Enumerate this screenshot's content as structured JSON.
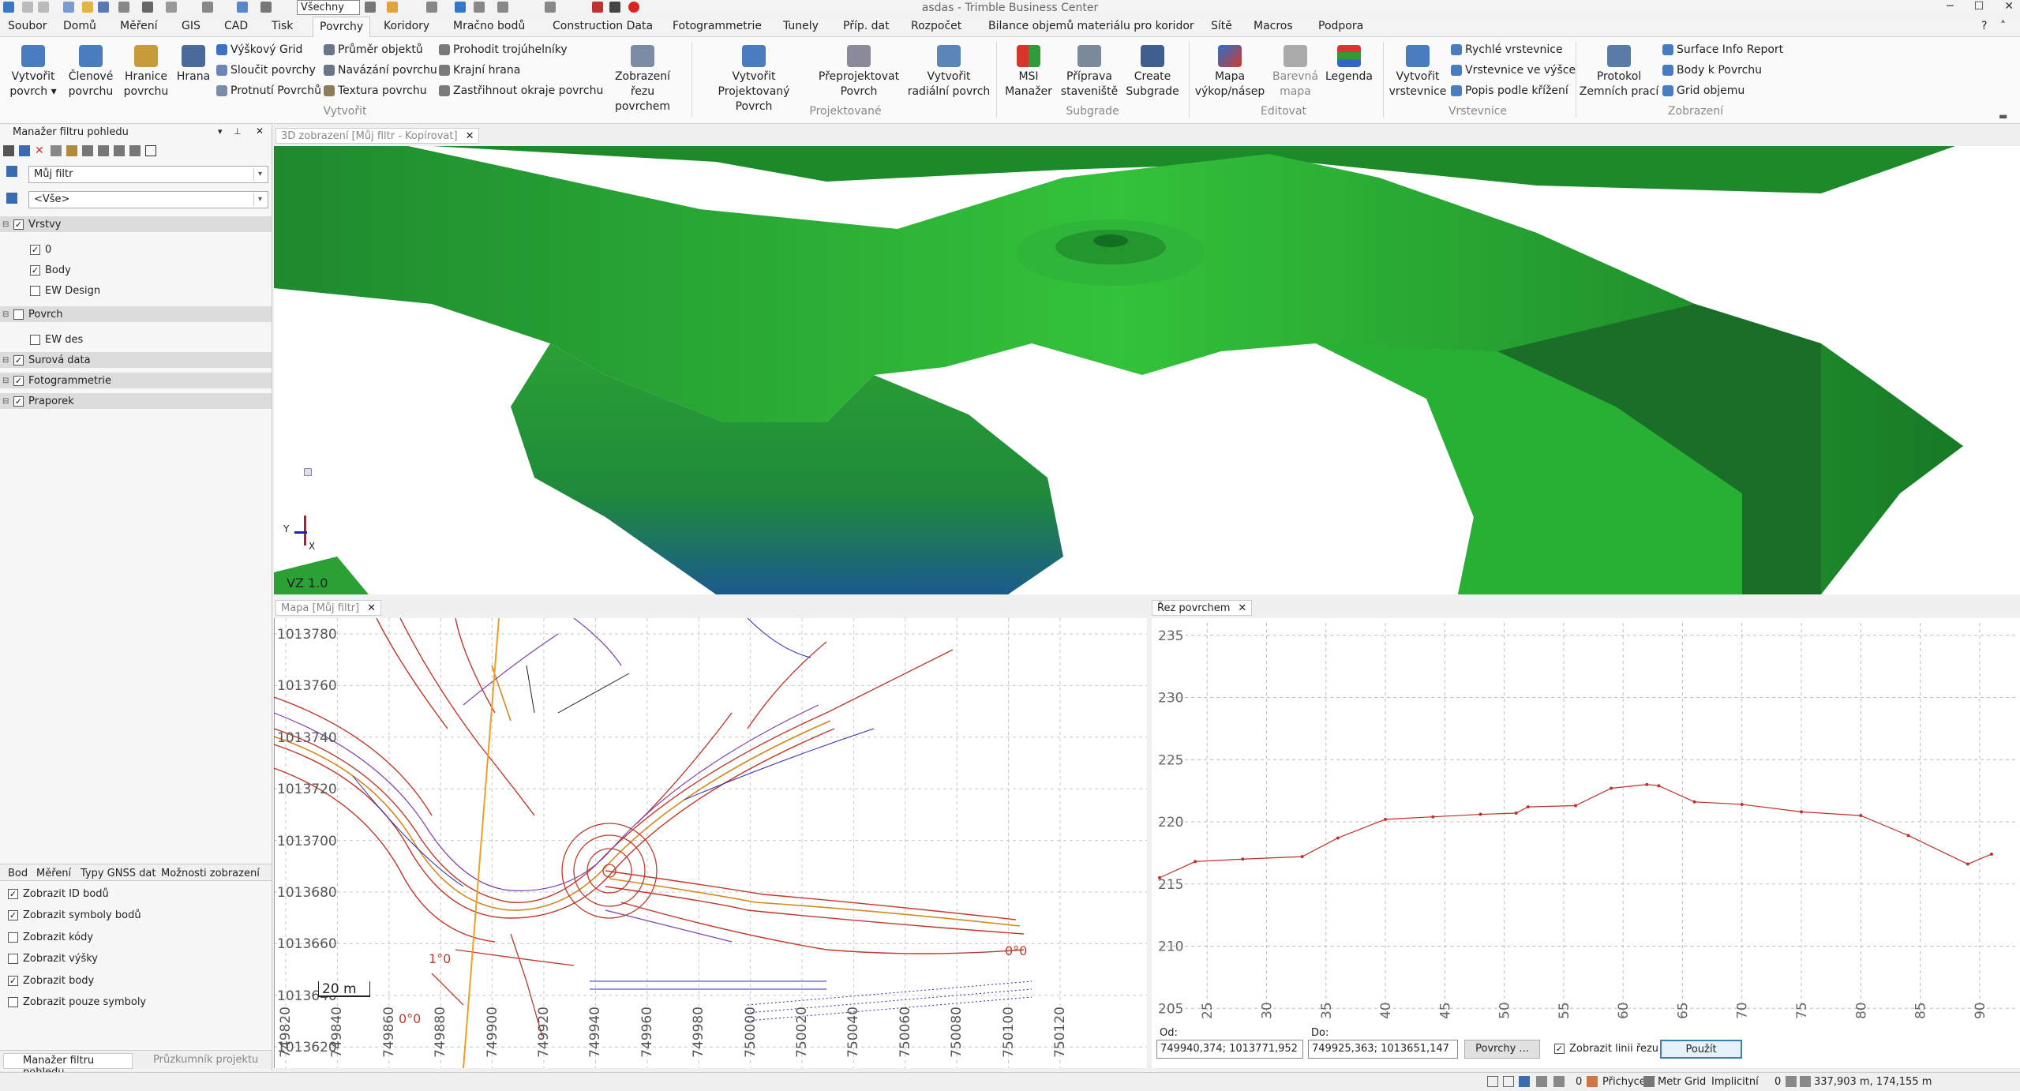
{
  "window": {
    "title": "asdas - Trimble Business Center",
    "help": "?",
    "minimize": "─",
    "maximize": "☐",
    "close": "✕"
  },
  "quick_access": {
    "combo_value": "Všechny"
  },
  "menu_tabs": [
    "Soubor",
    "Domů",
    "Měření",
    "GIS",
    "CAD",
    "Tisk",
    "Povrchy",
    "Koridory",
    "Mračno bodů",
    "Construction Data",
    "Fotogrammetrie",
    "Tunely",
    "Příp. dat",
    "Rozpočet",
    "Bilance objemů materiálu pro koridor",
    "Sítě",
    "Macros",
    "Podpora"
  ],
  "active_tab": "Povrchy",
  "ribbon": {
    "large": [
      {
        "label1": "Vytvořit",
        "label2": "povrch ▾"
      },
      {
        "label1": "Členové",
        "label2": "povrchu"
      },
      {
        "label1": "Hranice",
        "label2": "povrchu"
      },
      {
        "label1": "Hrana",
        "label2": ""
      },
      {
        "label1": "Zobrazení řezu",
        "label2": "povrchem"
      },
      {
        "label1": "Vytvořit",
        "label2": "Projektovaný Povrch"
      },
      {
        "label1": "Přeprojektovat",
        "label2": "Povrch"
      },
      {
        "label1": "Vytvořit",
        "label2": "radiální povrch"
      },
      {
        "label1": "MSI",
        "label2": "Manažer"
      },
      {
        "label1": "Příprava",
        "label2": "staveniště"
      },
      {
        "label1": "Create",
        "label2": "Subgrade"
      },
      {
        "label1": "Mapa",
        "label2": "výkop/násep"
      },
      {
        "label1": "Barevná",
        "label2": "mapa"
      },
      {
        "label1": "Legenda",
        "label2": ""
      },
      {
        "label1": "Vytvořit",
        "label2": "vrstevnice"
      },
      {
        "label1": "Protokol",
        "label2": "Zemních prací"
      }
    ],
    "small": [
      "Výškový Grid",
      "Sloučit povrchy",
      "Protnutí Povrchů",
      "Průměr objektů",
      "Navázání povrchu",
      "Textura povrchu",
      "Prohodit trojúhelníky",
      "Krajní hrana",
      "Zastřihnout okraje povrchu",
      "Rychlé vrstevnice",
      "Vrstevnice ve výšce",
      "Popis podle křížení",
      "Surface Info Report",
      "Body k Povrchu",
      "Grid objemu"
    ],
    "groups": [
      "Vytvořit",
      "Projektované",
      "Subgrade",
      "Editovat",
      "Vrstevnice",
      "Zobrazení"
    ]
  },
  "left_panel": {
    "title": "Manažer filtru pohledu",
    "filter_value": "Můj filtr",
    "scope_value": "<Vše>",
    "tree": [
      {
        "label": "Vrstvy",
        "checked": true,
        "cat": true
      },
      {
        "label": "0",
        "checked": true
      },
      {
        "label": "Body",
        "checked": true
      },
      {
        "label": "EW Design",
        "checked": false
      },
      {
        "label": "Povrch",
        "checked": false,
        "cat": true
      },
      {
        "label": "EW des",
        "checked": false
      },
      {
        "label": "Surová data",
        "checked": true,
        "cat": true
      },
      {
        "label": "Fotogrammetrie",
        "checked": true,
        "cat": true
      },
      {
        "label": "Praporek",
        "checked": true,
        "cat": true
      }
    ],
    "bottom_tabs": [
      "Bod",
      "Měření",
      "Typy GNSS dat",
      "Možnosti zobrazení"
    ],
    "options": [
      {
        "label": "Zobrazit ID bodů",
        "checked": true
      },
      {
        "label": "Zobrazit symboly bodů",
        "checked": true
      },
      {
        "label": "Zobrazit kódy",
        "checked": false
      },
      {
        "label": "Zobrazit výšky",
        "checked": false
      },
      {
        "label": "Zobrazit body",
        "checked": true
      },
      {
        "label": "Zobrazit pouze symboly",
        "checked": false
      }
    ],
    "footer_tabs": [
      "Manažer filtru pohledu",
      "Průzkumník projektu"
    ]
  },
  "view3d": {
    "tab": "3D zobrazení [Můj filtr - Kopírovat]",
    "close": "✕",
    "vz_label": "VZ  1.0",
    "axis_y": "Y",
    "axis_x": "X"
  },
  "map": {
    "tab": "Mapa [Můj filtr]",
    "close": "✕",
    "scale": "20 m",
    "y_labels": [
      "1013780",
      "1013760",
      "1013740",
      "1013720",
      "1013700",
      "1013680",
      "1013660",
      "1013640",
      "1013620"
    ],
    "x_labels": [
      "749820",
      "749840",
      "749860",
      "749880",
      "749900",
      "749920",
      "749940",
      "749960",
      "749980",
      "750000",
      "750020",
      "750040",
      "750060",
      "750080",
      "750100",
      "750120"
    ],
    "annot": [
      "0°0",
      "1°0",
      "0°0"
    ]
  },
  "profile": {
    "tab": "Řez povrchem",
    "close": "✕",
    "y_labels": [
      "235",
      "230",
      "225",
      "220",
      "215",
      "210",
      "205"
    ],
    "x_labels": [
      "25",
      "30",
      "35",
      "40",
      "45",
      "50",
      "55",
      "60",
      "65",
      "70",
      "75",
      "80",
      "85",
      "90"
    ],
    "od_label": "Od:",
    "od_value": "749940,374; 1013771,952",
    "do_label": "Do:",
    "do_value": "749925,363; 1013651,147",
    "surfaces_btn": "Povrchy ...",
    "show_line": "Zobrazit linii řezu",
    "show_line_checked": true,
    "apply_btn": "Použít"
  },
  "chart_data": {
    "type": "line",
    "title": "",
    "xlabel": "",
    "ylabel": "",
    "xlim": [
      21,
      93
    ],
    "ylim": [
      204,
      236
    ],
    "x": [
      21,
      24,
      28,
      33,
      36,
      40,
      44,
      48,
      51,
      52,
      56,
      59,
      62,
      63,
      66,
      70,
      75,
      80,
      84,
      89,
      91
    ],
    "y": [
      215.5,
      216.8,
      217.0,
      217.2,
      218.7,
      220.2,
      220.4,
      220.6,
      220.7,
      221.2,
      221.3,
      222.7,
      223.0,
      222.9,
      221.6,
      221.4,
      220.8,
      220.5,
      218.9,
      216.6,
      217.4
    ],
    "grid": true,
    "color": "#c0302a"
  },
  "status": {
    "zero": "0",
    "snap": "Přichycení",
    "unit": "Metr",
    "grid": "Grid",
    "implicit": "Implicitní",
    "coords": "337,903 m, 174,155 m"
  }
}
